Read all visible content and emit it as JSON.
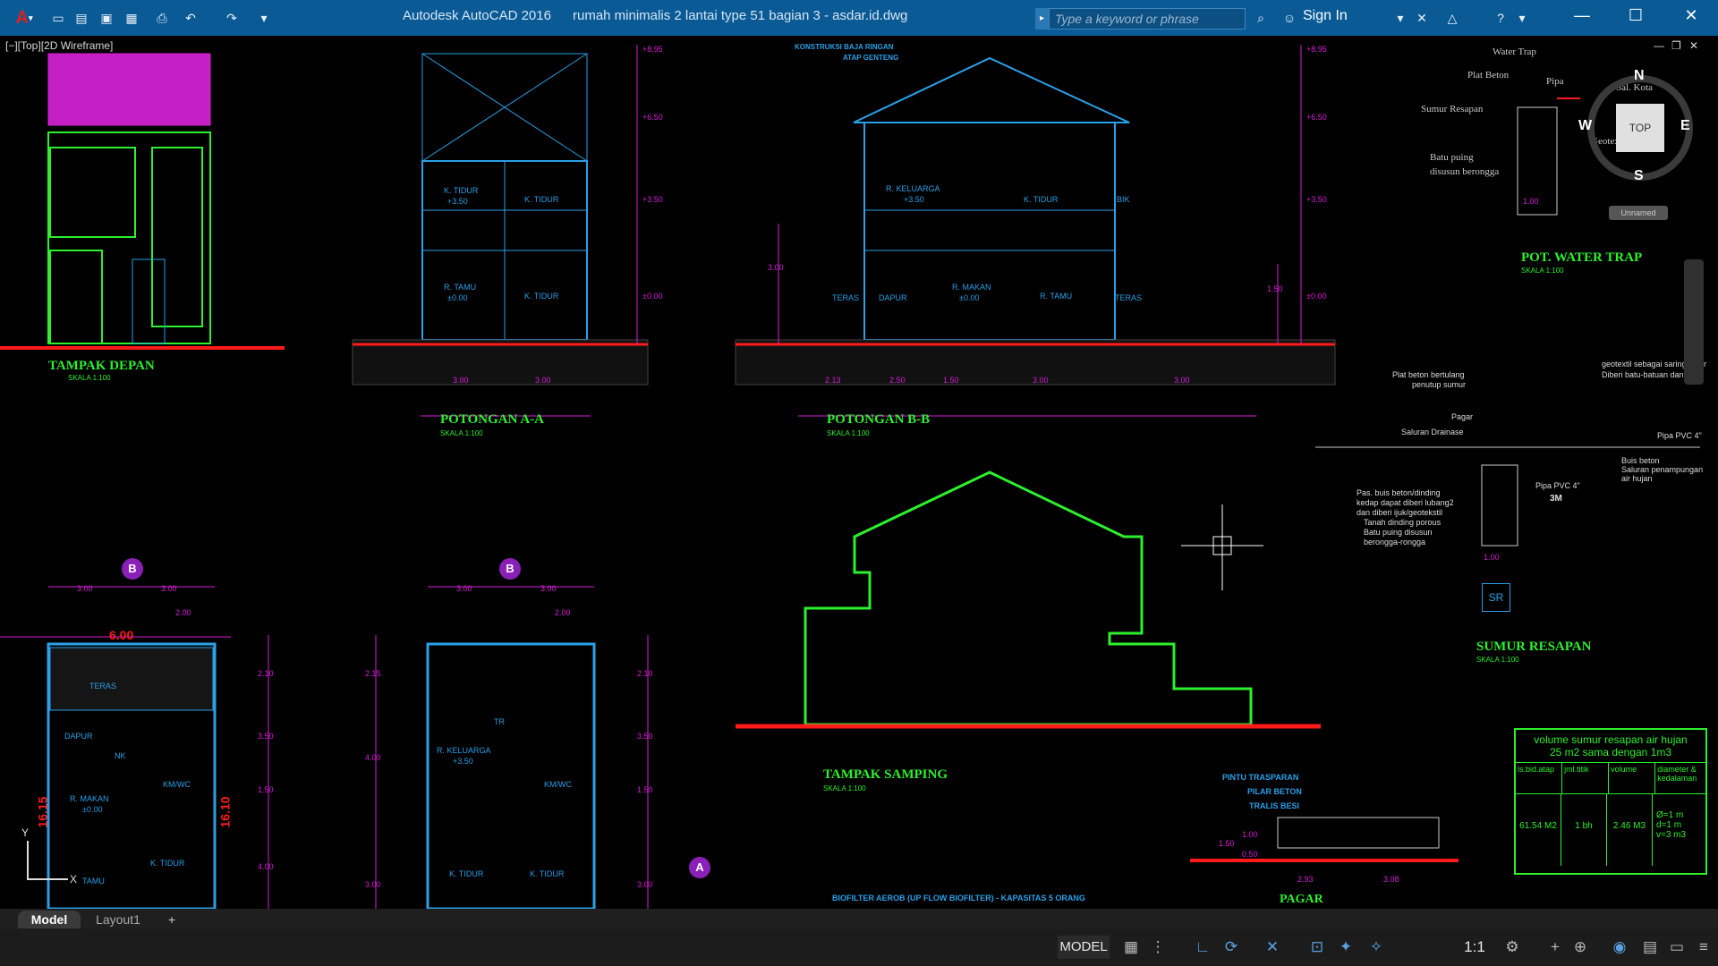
{
  "window": {
    "app_name": "Autodesk AutoCAD 2016",
    "document_title": "rumah minimalis 2 lantai type 51 bagian 3 - asdar.id.dwg",
    "app_logo": "A",
    "search_placeholder": "Type a keyword or phrase",
    "sign_in_label": "Sign In",
    "minimize_icon": "minimize-icon",
    "maximize_icon": "maximize-icon",
    "close_icon": "close-icon"
  },
  "quick_access": [
    "new-icon",
    "open-icon",
    "save-icon",
    "saveas-icon",
    "plot-icon",
    "undo-icon",
    "redo-icon"
  ],
  "viewport": {
    "label": "[−][Top][2D Wireframe]",
    "viewcube": {
      "face": "TOP",
      "north": "N",
      "south": "S",
      "east": "E",
      "west": "W",
      "ucs_label": "Unnamed"
    },
    "ucs_y": "Y",
    "ucs_x": "X"
  },
  "drawing": {
    "labels": {
      "tampak_depan": "TAMPAK DEPAN",
      "potongan_aa": "POTONGAN A-A",
      "potongan_bb": "POTONGAN B-B",
      "tampak_samping": "TAMPAK SAMPING",
      "pot_water_trap": "POT. WATER TRAP",
      "sumur_resapan": "SUMUR RESAPAN",
      "pagar": "PAGAR",
      "scale": "SKALA 1:100"
    },
    "section_aa_rooms": [
      "K. TIDUR",
      "+3.50",
      "K. TIDUR",
      "R. TAMU",
      "±0.00",
      "K. TIDUR"
    ],
    "section_bb_rooms": [
      "R. KELUARGA",
      "+3.50",
      "K. TIDUR",
      "R. MAKAN",
      "±0.00",
      "R. TAMU",
      "TERAS",
      "DAPUR",
      "TERAS",
      "BIK"
    ],
    "section_bb_notes": [
      "KONSTRUKSI BAJA RINGAN",
      "ATAP GENTENG"
    ],
    "section_aa_dims": [
      "3.00",
      "3.00"
    ],
    "section_bb_dims": [
      "2.13",
      "2.50",
      "1.50",
      "3.00",
      "3.00"
    ],
    "elevations": [
      "+8.95",
      "+6.50",
      "+3.50",
      "±0.00"
    ],
    "sumur_side": [
      "+8.95",
      "+6.50",
      "+3.50",
      "±0.00",
      "1.50",
      "3.00"
    ],
    "water_trap_notes": [
      "Water Trap",
      "Plat Beton",
      "Pipa",
      "Sal. Kota",
      "Sumur Resapan",
      "Geotextile",
      "Batu puing",
      "disusun berongga",
      "1.00"
    ],
    "sumur_notes": [
      "Plat beton bertulang",
      "penutup sumur",
      "Pagar",
      "Saluran Drainase",
      "geotextil sebagai saringan air",
      "Diberi batu-batuan dan ijuk",
      "Pipa PVC 4\"",
      "Buis beton",
      "Saluran penampungan",
      "air hujan",
      "Pipa PVC 4\"",
      "Pas. buis beton/dinding",
      "kedap dapat diberi lubang2",
      "dan diberi ijuk/geotekstil",
      "Tanah dinding porous",
      "Batu puing disusun",
      "berongga-rongga",
      "3M",
      "1.00",
      "SR"
    ],
    "plan1": {
      "top_dims": [
        "3.00",
        "3.00",
        "2.00"
      ],
      "width": "6.00",
      "depth": "16.15",
      "depth2": "16.10",
      "rooms": [
        "TERAS",
        "DAPUR",
        "NK",
        "R. MAKAN",
        "±0.00",
        "KM/WC",
        "K. TIDUR",
        "TAMU"
      ],
      "side_dims": [
        "2.10",
        "3.50",
        "1.50",
        "4.00"
      ]
    },
    "plan2": {
      "top_dims": [
        "3.00",
        "3.00",
        "2.00"
      ],
      "rooms": [
        "TR",
        "R. KELUARGA",
        "+3.50",
        "KM/WC",
        "K. TIDUR",
        "K. TIDUR"
      ],
      "side_dims": [
        "2.15",
        "4.00",
        "3.00",
        "2.10",
        "3.50",
        "1.50",
        "3.00"
      ]
    },
    "markers": [
      "B",
      "B",
      "A"
    ],
    "pagar_notes": [
      "PINTU TRASPARAN",
      "PILAR BETON",
      "TRALIS BESI",
      "1.00",
      "1.50",
      "0.50",
      "2.93",
      "3.08"
    ],
    "biofilter": "BIOFILTER AEROB (UP FLOW BIOFILTER) - KAPASITAS 5 ORANG"
  },
  "volume_table": {
    "title": "volume sumur resapan air hujan",
    "subtitle": "25 m2 sama dengan 1m3",
    "headers": [
      "ls.bid.atap",
      "jml.titik",
      "volume",
      "diameter & kedalaman"
    ],
    "row": [
      "61.54 M2",
      "1 bh",
      "2.46 M3",
      "Ø=1 m\nd=1 m\nv=3 m3"
    ]
  },
  "layout_tabs": [
    "Model",
    "Layout1",
    "+"
  ],
  "statusbar": {
    "model_label": "MODEL",
    "scale_label": "1:1"
  },
  "colors": {
    "titlebar": "#0a5a96",
    "cad_blue": "#2aa0e8",
    "cad_green": "#2cf02c",
    "cad_red": "#ff1a1a",
    "cad_magenta": "#d81bd8"
  }
}
